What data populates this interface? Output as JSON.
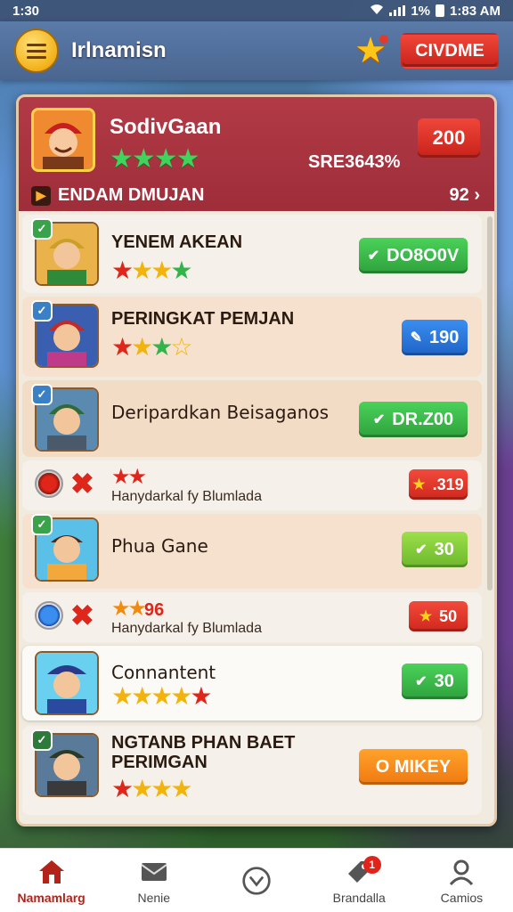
{
  "status": {
    "time": "1:30",
    "right_text": "1% ",
    "clock": "1:83 AM"
  },
  "appbar": {
    "title": "Irlnamisn",
    "action_label": "CIVDME"
  },
  "header": {
    "name": "SodivGaan",
    "stars": "★★★★",
    "code": "SRE3643%",
    "pill": "200",
    "sub_label": "ENDAM DMUJAN",
    "more": "92 ›"
  },
  "rows": [
    {
      "title": "YENEM AKEAN",
      "button": "DO8O0V",
      "badge": "?"
    },
    {
      "title": "PERINGKAT PEMJAN",
      "button": "190",
      "badge": "?"
    },
    {
      "title": "Deripardkan Beisaganos",
      "button": "DR.Z00",
      "badge": "?"
    },
    {
      "caption": "Hanydarkal fy Blumlada",
      "button": ".319"
    },
    {
      "title": "Phua Gane",
      "button": "30"
    },
    {
      "stars_text": "96",
      "caption": "Hanydarkal fy Blumlada",
      "button": "50"
    },
    {
      "title": "Connantent",
      "button": "30"
    },
    {
      "title_line1": "NGTANB PHAN BAET",
      "title_line2": "PERIMGAN",
      "button": "O MIKEY",
      "badge": "?"
    }
  ],
  "nav": [
    {
      "label": "Namamlarg",
      "icon": "home-icon"
    },
    {
      "label": "Nenie",
      "icon": "mail-icon"
    },
    {
      "label": "",
      "icon": "profile-icon"
    },
    {
      "label": "Brandalla",
      "icon": "tag-icon",
      "badge": "1"
    },
    {
      "label": "Camios",
      "icon": "user-icon"
    }
  ]
}
